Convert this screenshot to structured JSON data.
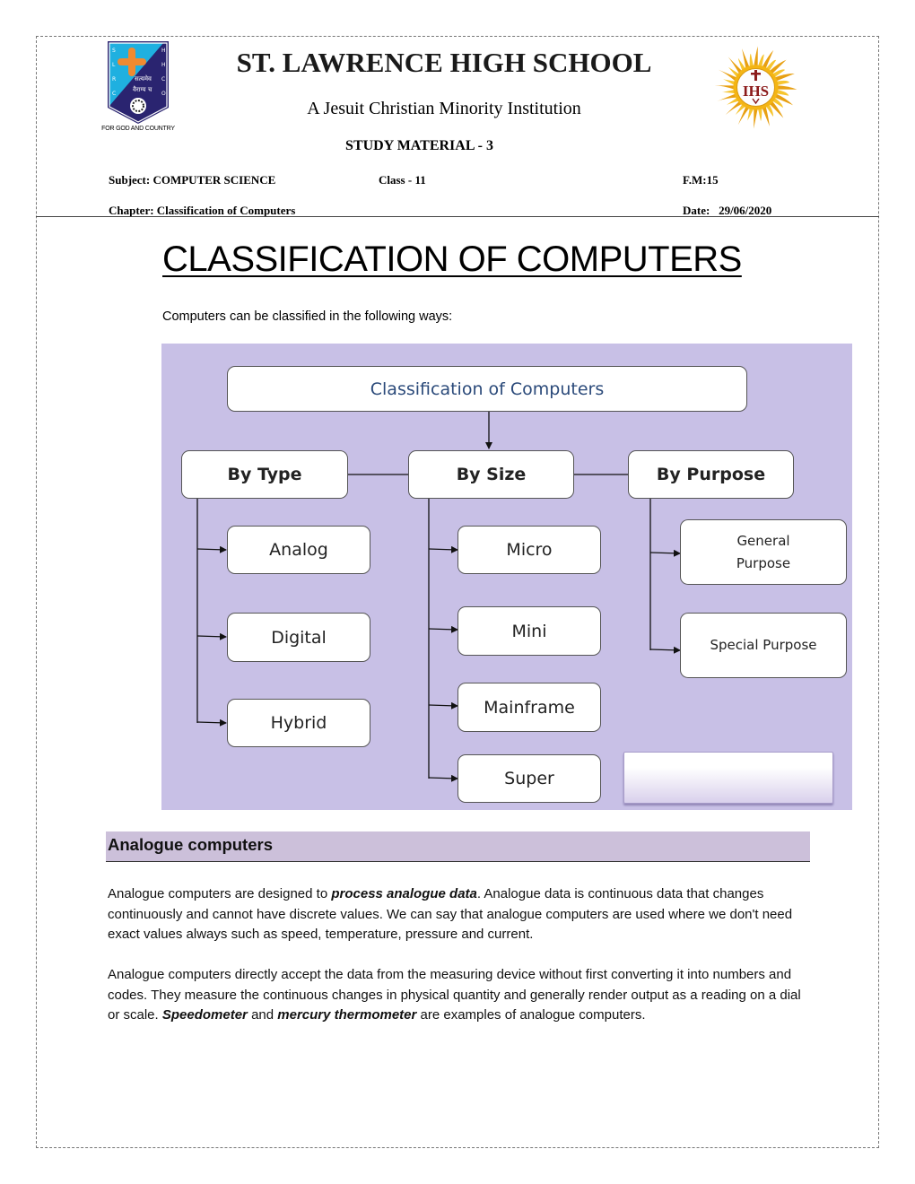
{
  "header": {
    "school_name": "ST. LAWRENCE HIGH SCHOOL",
    "tagline": "A Jesuit Christian Minority Institution",
    "material": "STUDY MATERIAL - 3",
    "left_logo_caption": "FOR GOD AND COUNTRY",
    "left_logo_left_letters": "ST. LAWRENCE",
    "left_logo_right_letters": "HIGH SCHOOL",
    "right_logo_text": "IHS",
    "subject": "Subject: COMPUTER SCIENCE",
    "class": "Class - 11",
    "full_marks": "F.M:15",
    "chapter": "Chapter: Classification of Computers",
    "date": "Date:   29/06/2020"
  },
  "title": "CLASSIFICATION OF COMPUTERS",
  "intro": "Computers can be classified in the following ways:",
  "diagram": {
    "root": "Classification  of Computers",
    "categories": [
      {
        "label": "By Type",
        "items": [
          "Analog",
          "Digital",
          "Hybrid"
        ]
      },
      {
        "label": "By Size",
        "items": [
          "Micro",
          "Mini",
          "Mainframe",
          "Super"
        ]
      },
      {
        "label": "By Purpose",
        "items": [
          "General Purpose",
          "Special Purpose"
        ]
      }
    ],
    "colors": {
      "background": "#c8c0e6",
      "root_text": "#2b4a7a"
    }
  },
  "section": {
    "heading": "Analogue computers",
    "heading_bg": "#ccc0da",
    "p1_a": "Analogue computers are designed to ",
    "p1_b": "process analogue data",
    "p1_c": ". Analogue data is continuous data that changes continuously and cannot have discrete values. We can say that analogue computers are used where we don't need exact values always such as speed, temperature, pressure and current.",
    "p2_a": "Analogue computers directly accept the data from the measuring device without first converting it into numbers and codes. They measure the continuous changes in physical quantity and generally render output as a reading on a dial or scale. ",
    "p2_b": "Speedometer",
    "p2_c": " and ",
    "p2_d": "mercury thermometer",
    "p2_e": " are examples of analogue computers."
  }
}
